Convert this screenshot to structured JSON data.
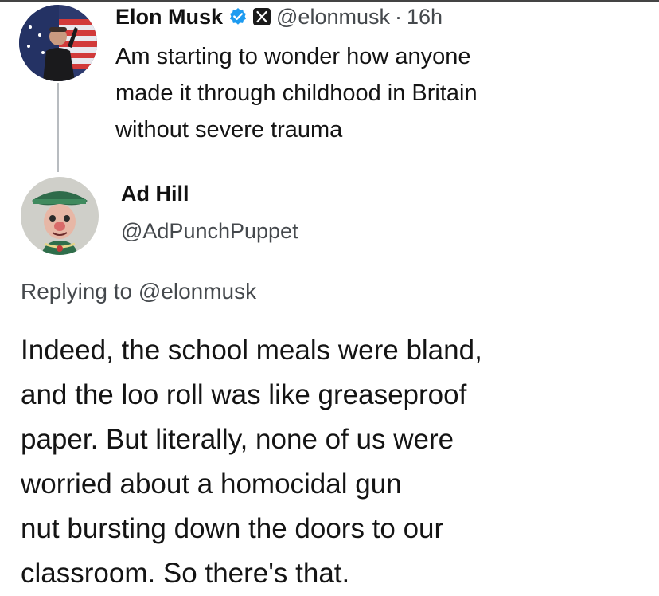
{
  "original_tweet": {
    "author_name": "Elon Musk",
    "handle": "@elonmusk",
    "separator": "·",
    "time": "16h",
    "verified_color": "#1d9bf0",
    "badge_icon": "x-logo-icon",
    "text_lines": [
      "Am starting to wonder how anyone",
      "made it through childhood in Britain",
      "without severe trauma"
    ]
  },
  "reply_tweet": {
    "author_name": "Ad Hill",
    "handle": "@AdPunchPuppet",
    "replying_prefix": "Replying to",
    "replying_mention": "@elonmusk",
    "text_lines": [
      "Indeed, the school meals were bland,",
      "and the loo roll was like greaseproof",
      "paper. But literally, none of us were",
      "worried about a homocidal gun",
      "nut bursting down the doors to our",
      "classroom. So there's that."
    ]
  }
}
